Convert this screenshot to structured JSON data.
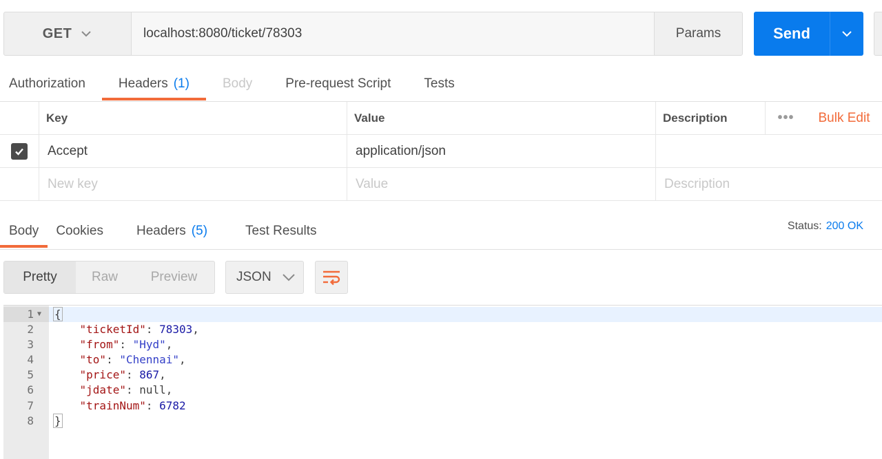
{
  "request": {
    "method": "GET",
    "url": "localhost:8080/ticket/78303",
    "params_label": "Params",
    "send_label": "Send"
  },
  "request_tabs": [
    {
      "label": "Authorization",
      "count": ""
    },
    {
      "label": "Headers",
      "count": "(1)"
    },
    {
      "label": "Body",
      "count": ""
    },
    {
      "label": "Pre-request Script",
      "count": ""
    },
    {
      "label": "Tests",
      "count": ""
    }
  ],
  "headers_table": {
    "columns": {
      "key": "Key",
      "value": "Value",
      "description": "Description"
    },
    "dots": "•••",
    "bulk_edit": "Bulk Edit",
    "rows": [
      {
        "checked": true,
        "key": "Accept",
        "value": "application/json",
        "description": ""
      }
    ],
    "placeholders": {
      "key": "New key",
      "value": "Value",
      "description": "Description"
    }
  },
  "response_tabs": [
    {
      "label": "Body",
      "count": ""
    },
    {
      "label": "Cookies",
      "count": ""
    },
    {
      "label": "Headers",
      "count": "(5)"
    },
    {
      "label": "Test Results",
      "count": ""
    }
  ],
  "status": {
    "label": "Status:",
    "value": "200 OK"
  },
  "view_modes": [
    "Pretty",
    "Raw",
    "Preview"
  ],
  "format": "JSON",
  "code_lines": [
    {
      "num": "1",
      "text": "{"
    },
    {
      "num": "2",
      "key": "\"ticketId\"",
      "sep": ": ",
      "val": "78303",
      "type": "n",
      "end": ","
    },
    {
      "num": "3",
      "key": "\"from\"",
      "sep": ": ",
      "val": "\"Hyd\"",
      "type": "s",
      "end": ","
    },
    {
      "num": "4",
      "key": "\"to\"",
      "sep": ": ",
      "val": "\"Chennai\"",
      "type": "s",
      "end": ","
    },
    {
      "num": "5",
      "key": "\"price\"",
      "sep": ": ",
      "val": "867",
      "type": "n",
      "end": ","
    },
    {
      "num": "6",
      "key": "\"jdate\"",
      "sep": ": ",
      "val": "null",
      "type": "p",
      "end": ","
    },
    {
      "num": "7",
      "key": "\"trainNum\"",
      "sep": ": ",
      "val": "6782",
      "type": "n",
      "end": ""
    },
    {
      "num": "8",
      "text": "}"
    }
  ],
  "colors": {
    "accent": "#f26b3a",
    "primary": "#097bed"
  }
}
